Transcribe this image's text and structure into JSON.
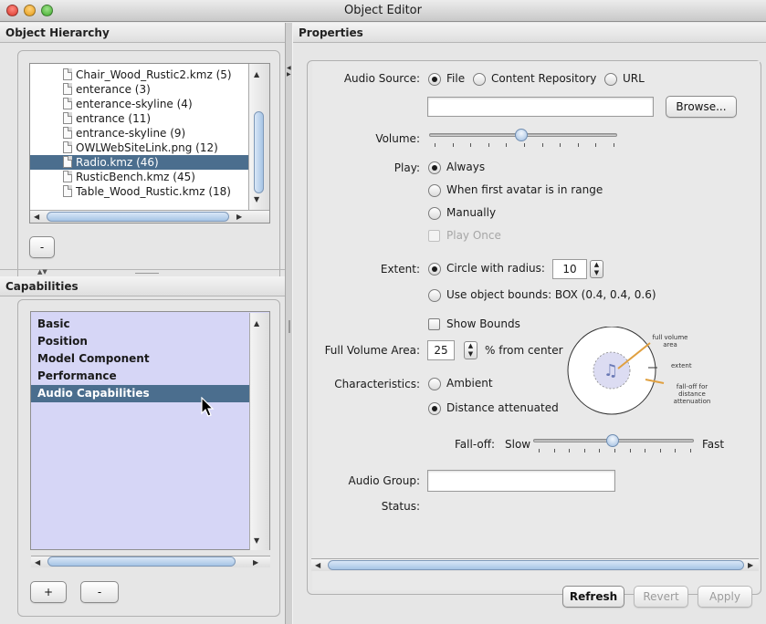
{
  "window": {
    "title": "Object Editor"
  },
  "hierarchy": {
    "header": "Object Hierarchy",
    "items": [
      "Chair_Wood_Rustic2.kmz (5)",
      "enterance (3)",
      "enterance-skyline (4)",
      "entrance (11)",
      "entrance-skyline (9)",
      "OWLWebSiteLink.png (12)",
      "Radio.kmz (46)",
      "RusticBench.kmz (45)",
      "Table_Wood_Rustic.kmz (18)"
    ],
    "selected_index": 6,
    "remove_label": "-"
  },
  "capabilities": {
    "header": "Capabilities",
    "items": [
      "Basic",
      "Position",
      "Model Component",
      "Performance",
      "Audio Capabilities"
    ],
    "selected_index": 4,
    "add_label": "+",
    "remove_label": "-"
  },
  "properties": {
    "header": "Properties",
    "audio_source": {
      "label": "Audio Source:",
      "options": [
        "File",
        "Content Repository",
        "URL"
      ],
      "selected": "File",
      "value": "",
      "browse_label": "Browse..."
    },
    "volume": {
      "label": "Volume:",
      "level": 0.48
    },
    "play": {
      "label": "Play:",
      "options": [
        "Always",
        "When first avatar is in range",
        "Manually"
      ],
      "selected": "Always",
      "play_once_label": "Play Once"
    },
    "extent": {
      "label": "Extent:",
      "circle_label": "Circle with radius:",
      "radius": "10",
      "bounds_label": "Use object bounds:  BOX (0.4, 0.4, 0.6)",
      "selected": "circle",
      "show_bounds_label": "Show Bounds"
    },
    "full_volume": {
      "label": "Full Volume Area:",
      "value": "25",
      "suffix": "% from center"
    },
    "characteristics": {
      "label": "Characteristics:",
      "options": [
        "Ambient",
        "Distance attenuated"
      ],
      "selected": "Distance attenuated"
    },
    "falloff": {
      "label": "Fall-off:",
      "slow_label": "Slow",
      "fast_label": "Fast",
      "level": 0.48
    },
    "diagram": {
      "full_volume_area_label": "full volume\narea",
      "extent_label": "extent",
      "falloff_label": "fall-off for\ndistance\nattenuation"
    },
    "audio_group": {
      "label": "Audio Group:",
      "value": ""
    },
    "status": {
      "label": "Status:",
      "value": ""
    },
    "buttons": {
      "refresh": "Refresh",
      "revert": "Revert",
      "apply": "Apply"
    }
  },
  "colors": {
    "selection": "#4b6e8e",
    "capability_list_bg": "#d6d6f6",
    "diagram_accent": "#e0a040"
  }
}
